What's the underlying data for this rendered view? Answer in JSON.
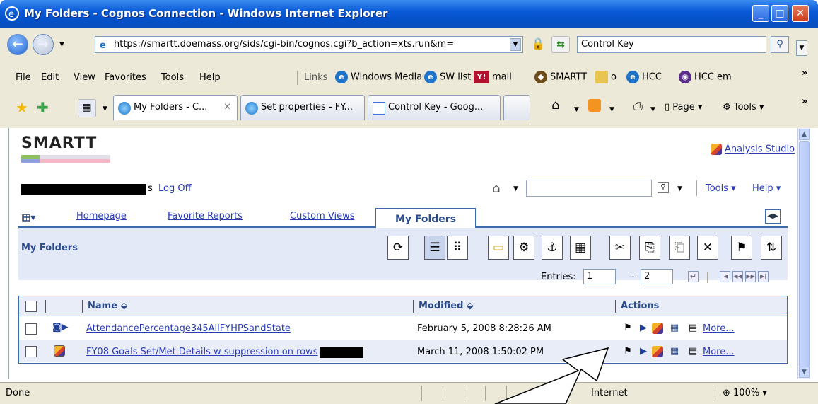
{
  "window": {
    "title": "My Folders - Cognos Connection - Windows Internet Explorer"
  },
  "address": {
    "url": "https://smartt.doemass.org/sids/cgi-bin/cognos.cgi?b_action=xts.run&m=",
    "search": "Control Key"
  },
  "menu": {
    "file": "File",
    "edit": "Edit",
    "view": "View",
    "favorites": "Favorites",
    "tools": "Tools",
    "help": "Help",
    "links": "Links"
  },
  "links_bar": [
    {
      "label": "Windows Media",
      "icon": "ie-icon"
    },
    {
      "label": "SW list",
      "icon": "ie-icon"
    },
    {
      "label": "mail",
      "icon": "yahoo-icon"
    },
    {
      "label": "SMARTT",
      "icon": "smartt-icon"
    },
    {
      "label": "o",
      "icon": "folder-icon"
    },
    {
      "label": "HCC",
      "icon": "ie-icon"
    },
    {
      "label": "HCC em",
      "icon": "hcc-icon"
    }
  ],
  "tabs": [
    {
      "label": "My Folders - C...",
      "active": true
    },
    {
      "label": "Set properties - FY...",
      "active": false
    },
    {
      "label": "Control Key - Goog...",
      "active": false
    }
  ],
  "ie_tools": {
    "page": "Page",
    "tools": "Tools"
  },
  "app": {
    "logo": "SMARTT",
    "analysis_studio": "Analysis Studio",
    "user_suffix": "s",
    "log_off": "Log Off",
    "tools": "Tools",
    "help": "Help",
    "tabs": {
      "homepage": "Homepage",
      "favorite_reports": "Favorite Reports",
      "custom_views": "Custom Views",
      "my_folders": "My Folders"
    },
    "page_title": "My Folders",
    "entries_label": "Entries:",
    "entries_from": "1",
    "entries_to": "2",
    "dash": "-",
    "columns": {
      "name": "Name ⬙",
      "modified": "Modified ⬙",
      "actions": "Actions"
    },
    "rows": [
      {
        "name": "AttendancePercentage345AllFYHPSandState",
        "modified": "February 5, 2008 8:28:26 AM",
        "more": "More..."
      },
      {
        "name": "FY08 Goals Set/Met Details w suppression on rows",
        "modified": "March 11, 2008 1:50:02 PM",
        "more": "More..."
      }
    ]
  },
  "status": {
    "text": "Done",
    "zone": "Internet",
    "zoom": "100%"
  }
}
